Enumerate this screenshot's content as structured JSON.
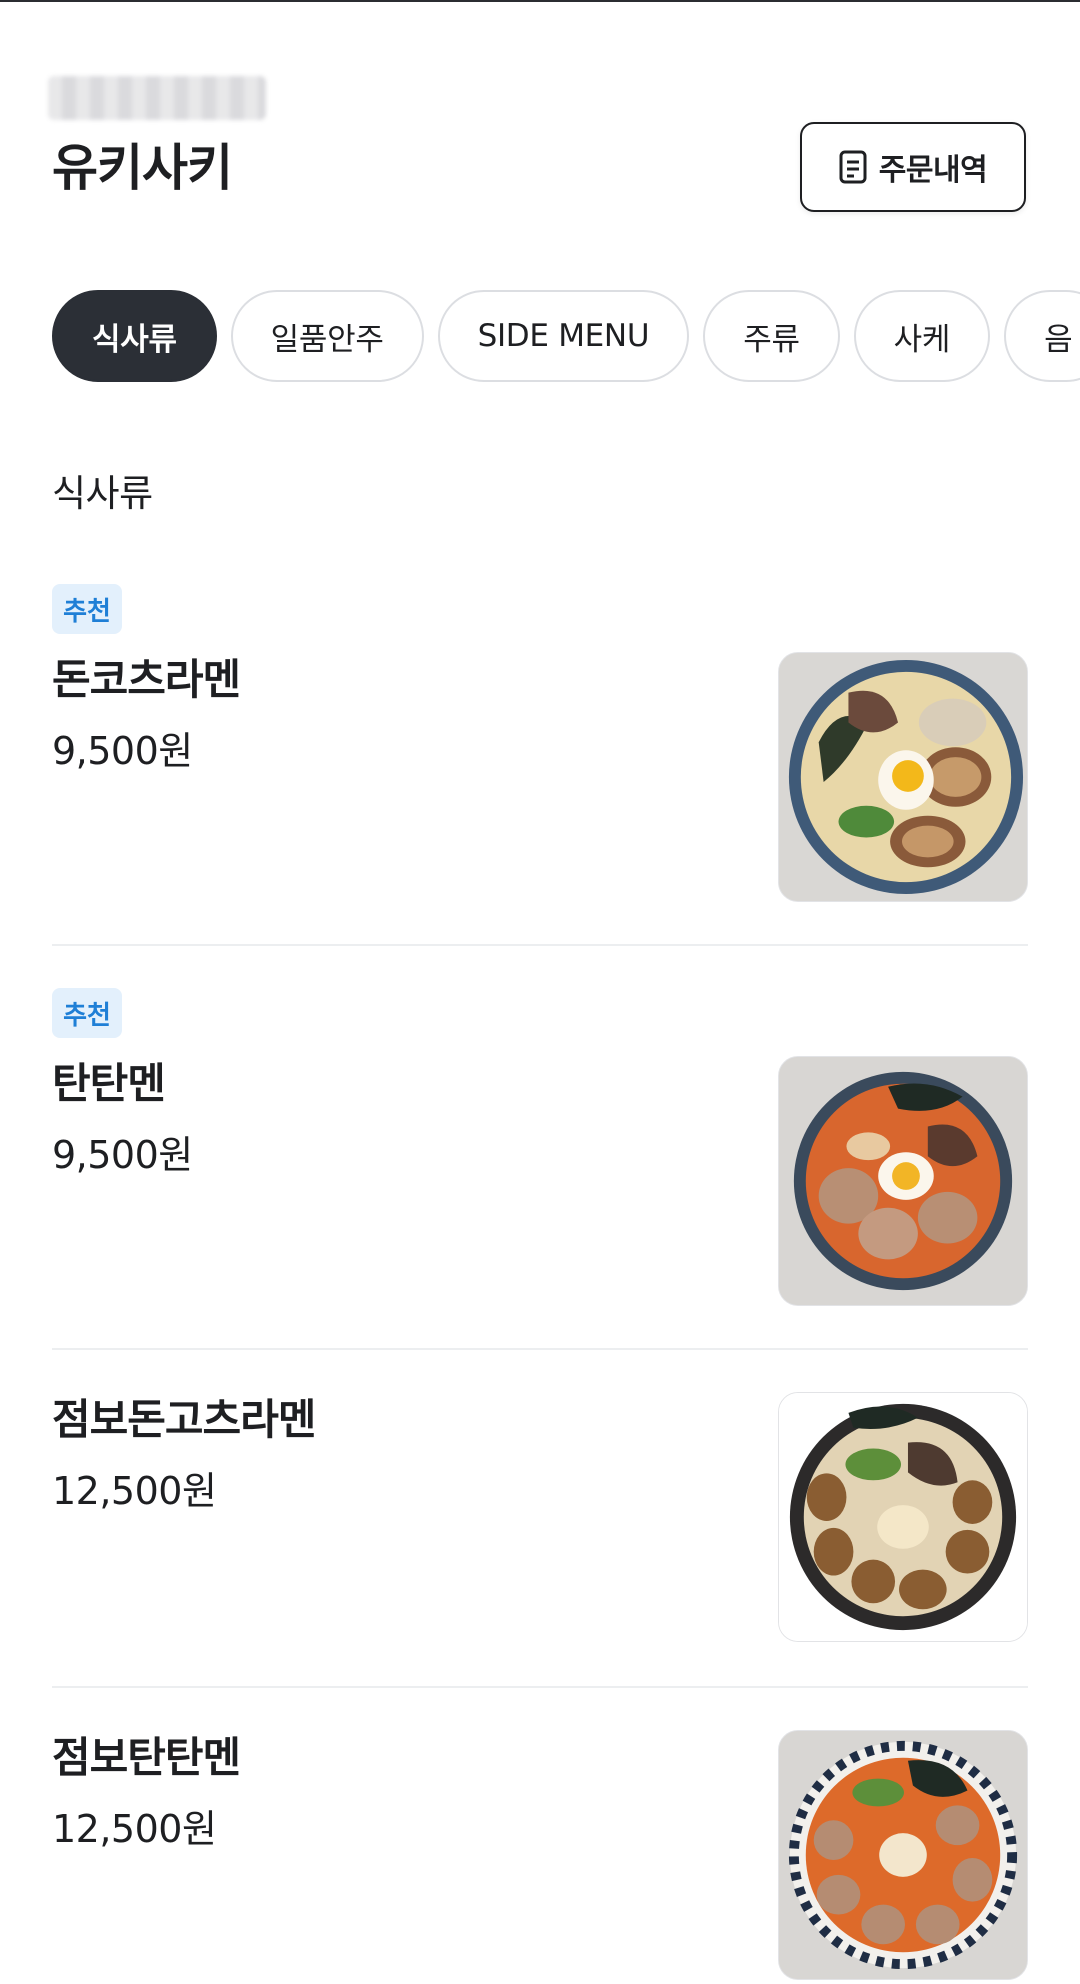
{
  "header": {
    "store_title": "유키사키",
    "order_history_label": "주문내역"
  },
  "tabs": [
    {
      "label": "식사류",
      "active": true
    },
    {
      "label": "일품안주",
      "active": false
    },
    {
      "label": "SIDE MENU",
      "active": false
    },
    {
      "label": "주류",
      "active": false
    },
    {
      "label": "사케",
      "active": false
    },
    {
      "label": "음",
      "active": false
    }
  ],
  "section": {
    "title": "식사류"
  },
  "items": [
    {
      "badge": "추천",
      "name": "돈코츠라멘",
      "price": "9,500원",
      "image": "tonkotsu-ramen-photo"
    },
    {
      "badge": "추천",
      "name": "탄탄멘",
      "price": "9,500원",
      "image": "tantanmen-photo"
    },
    {
      "badge": "",
      "name": "점보돈고츠라멘",
      "price": "12,500원",
      "image": "jumbo-tonkotsu-ramen-photo"
    },
    {
      "badge": "",
      "name": "점보탄탄멘",
      "price": "12,500원",
      "image": "jumbo-tantanmen-photo"
    }
  ],
  "colors": {
    "active_tab": "#2b2f36",
    "badge_bg": "#e3f0fc",
    "badge_text": "#1f7fd6",
    "text": "#1e1f22"
  }
}
